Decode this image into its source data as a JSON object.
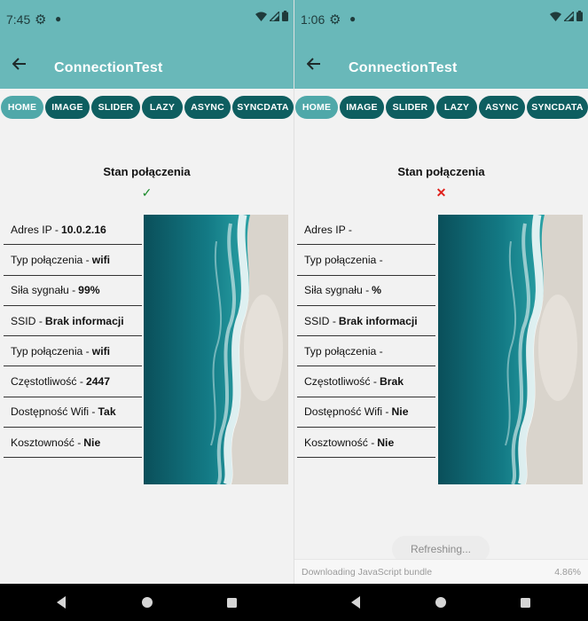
{
  "left": {
    "status_time": "7:45",
    "app_title": "ConnectionTest",
    "tabs": [
      {
        "label": "HOME"
      },
      {
        "label": "IMAGE"
      },
      {
        "label": "SLIDER"
      },
      {
        "label": "LAZY"
      },
      {
        "label": "ASYNC"
      },
      {
        "label": "SYNCDATA"
      }
    ],
    "state_title": "Stan połączenia",
    "state_icon": "✓",
    "rows": [
      {
        "label": "Adres IP - ",
        "value": "10.0.2.16"
      },
      {
        "label": "Typ połączenia - ",
        "value": "wifi"
      },
      {
        "label": "Siła sygnału - ",
        "value": "99%"
      },
      {
        "label": "SSID - ",
        "value": "Brak informacji"
      },
      {
        "label": "Typ połączenia - ",
        "value": "wifi"
      },
      {
        "label": "Częstotliwość - ",
        "value": "2447"
      },
      {
        "label": "Dostępność Wifi - ",
        "value": "Tak"
      },
      {
        "label": "Kosztowność - ",
        "value": "Nie"
      }
    ]
  },
  "right": {
    "status_time": "1:06",
    "app_title": "ConnectionTest",
    "tabs": [
      {
        "label": "HOME"
      },
      {
        "label": "IMAGE"
      },
      {
        "label": "SLIDER"
      },
      {
        "label": "LAZY"
      },
      {
        "label": "ASYNC"
      },
      {
        "label": "SYNCDATA"
      }
    ],
    "state_title": "Stan połączenia",
    "state_icon": "✕",
    "rows": [
      {
        "label": "Adres IP - ",
        "value": ""
      },
      {
        "label": "Typ połączenia - ",
        "value": ""
      },
      {
        "label": "Siła sygnału - ",
        "value": "%"
      },
      {
        "label": "SSID - ",
        "value": "Brak informacji"
      },
      {
        "label": "Typ połączenia - ",
        "value": ""
      },
      {
        "label": "Częstotliwość - ",
        "value": "Brak"
      },
      {
        "label": "Dostępność Wifi - ",
        "value": "Nie"
      },
      {
        "label": "Kosztowność - ",
        "value": "Nie"
      }
    ],
    "refreshing_text": "Refreshing...",
    "download_text": "Downloading JavaScript bundle",
    "download_percent": "4.86%"
  },
  "colors": {
    "appbar": "#69b8b9",
    "tab": "#0e5e60",
    "tab_active": "#4fa8a9",
    "ok": "#1a8a2a",
    "error": "#e0201b"
  },
  "icons": {
    "status_settings": "gear-icon",
    "status_wifi": "wifi-icon",
    "status_signal": "signal-icon",
    "status_battery": "battery-icon",
    "back": "arrow-back-icon",
    "nav_back": "triangle-back-icon",
    "nav_home": "circle-home-icon",
    "nav_recents": "square-recents-icon"
  }
}
